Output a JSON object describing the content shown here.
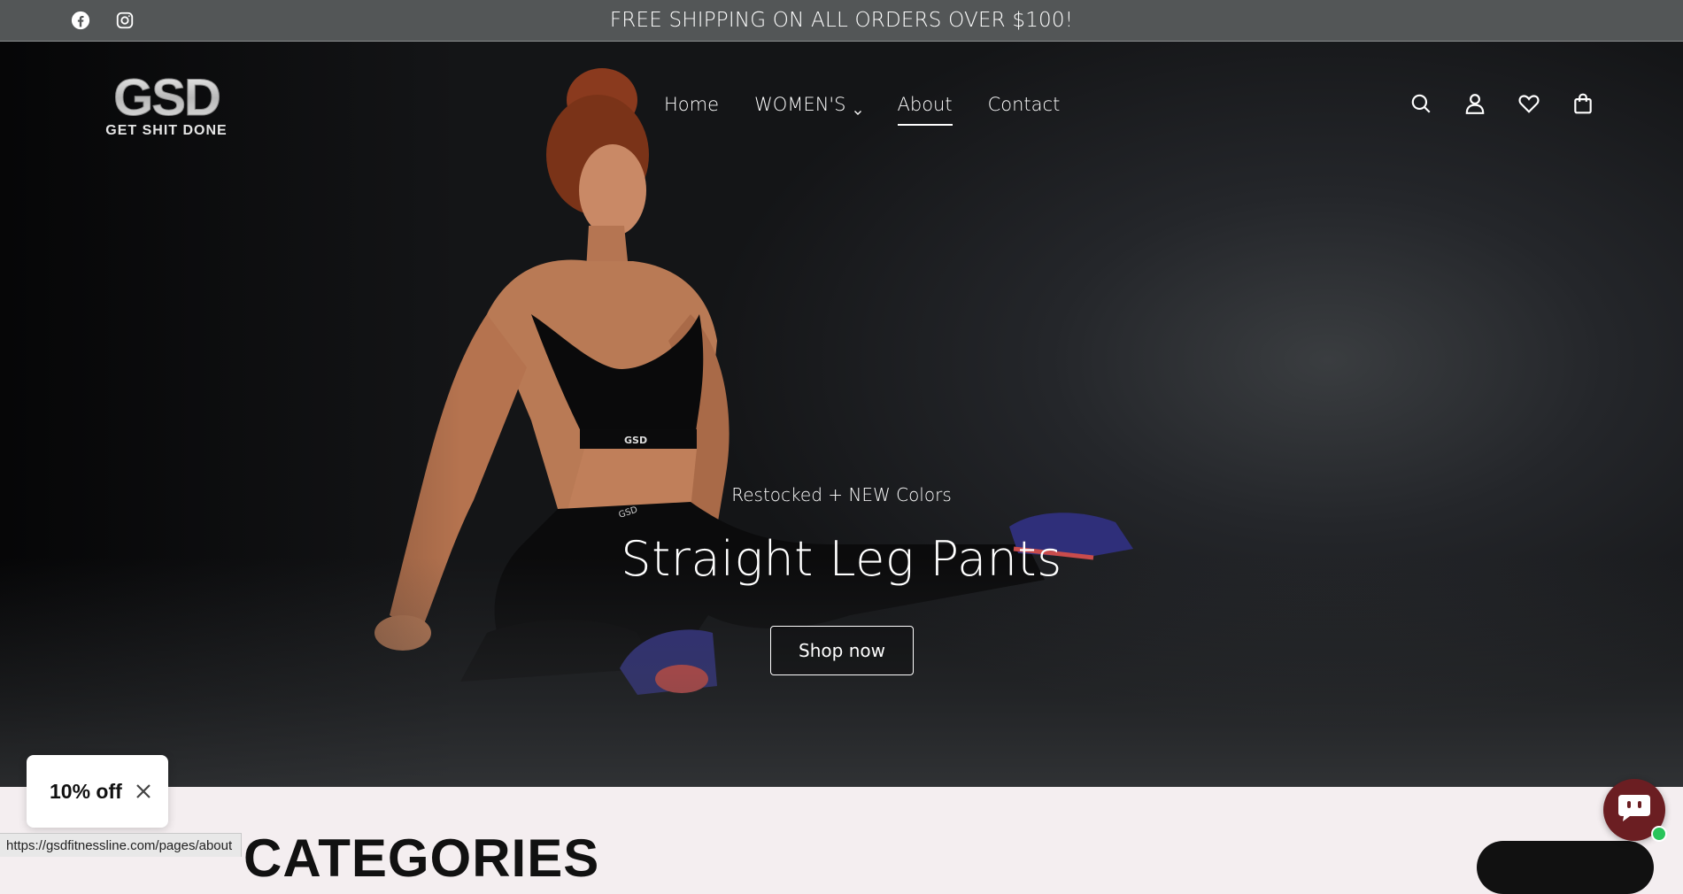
{
  "topbar": {
    "announcement": "FREE SHIPPING ON ALL ORDERS OVER $100!",
    "social_icons": [
      "facebook-icon",
      "instagram-icon"
    ]
  },
  "header": {
    "logo_text": "GSD",
    "logo_tagline": "GET SHIT DONE",
    "nav": [
      {
        "label": "Home"
      },
      {
        "label": "WOMEN'S"
      },
      {
        "label": "About"
      },
      {
        "label": "Contact"
      }
    ],
    "icons": [
      "search-icon",
      "account-icon",
      "wishlist-icon",
      "cart-icon"
    ]
  },
  "hero": {
    "eyebrow": "Restocked + NEW Colors",
    "headline": "Straight Leg Pants",
    "cta_label": "Shop now"
  },
  "section": {
    "heading": "CATEGORIES"
  },
  "popup": {
    "discount_label": "10% off"
  },
  "status_bar": {
    "url": "https://gsdfitnessline.com/pages/about"
  },
  "colors": {
    "topbar_bg": "#535657",
    "page_bg": "#f4eef0",
    "chat_bg": "#6b1e22",
    "online_dot": "#29c45a"
  }
}
